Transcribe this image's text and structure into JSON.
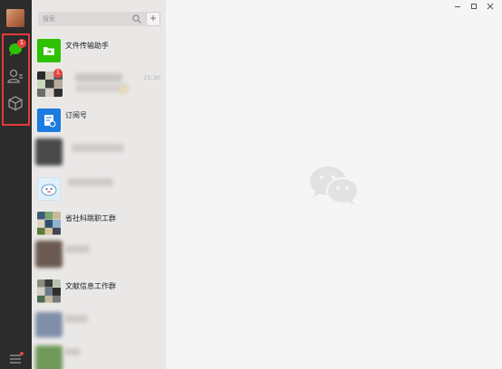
{
  "sidebar": {
    "chat_badge": "1"
  },
  "search": {
    "placeholder": "搜索"
  },
  "chats": [
    {
      "name": "文件传输助手",
      "time": "",
      "badge": ""
    },
    {
      "name": "",
      "time": "15:30",
      "badge": "1"
    },
    {
      "name": "订阅号",
      "time": "",
      "badge": ""
    },
    {
      "name": "",
      "time": "",
      "badge": ""
    },
    {
      "name": "",
      "time": "",
      "badge": ""
    },
    {
      "name": "省社科跳职工群",
      "time": "",
      "badge": ""
    },
    {
      "name": "",
      "time": "",
      "badge": ""
    },
    {
      "name": "文献信息工作群",
      "time": "",
      "badge": ""
    },
    {
      "name": "",
      "time": "",
      "badge": ""
    },
    {
      "name": "",
      "time": "",
      "badge": ""
    }
  ],
  "colors": {
    "brand_green": "#2dc100",
    "badge_red": "#e64340",
    "highlight_red": "#e23a3a",
    "nav_bg": "#2c2c2c",
    "list_bg": "#eae8e7"
  },
  "icons": [
    "chat-icon",
    "contacts-icon",
    "favorites-box-icon",
    "menu-icon",
    "search-icon",
    "plus-icon",
    "folder-icon",
    "subscription-icon",
    "wechat-logo-icon",
    "minimize-icon",
    "maximize-icon",
    "close-icon"
  ]
}
